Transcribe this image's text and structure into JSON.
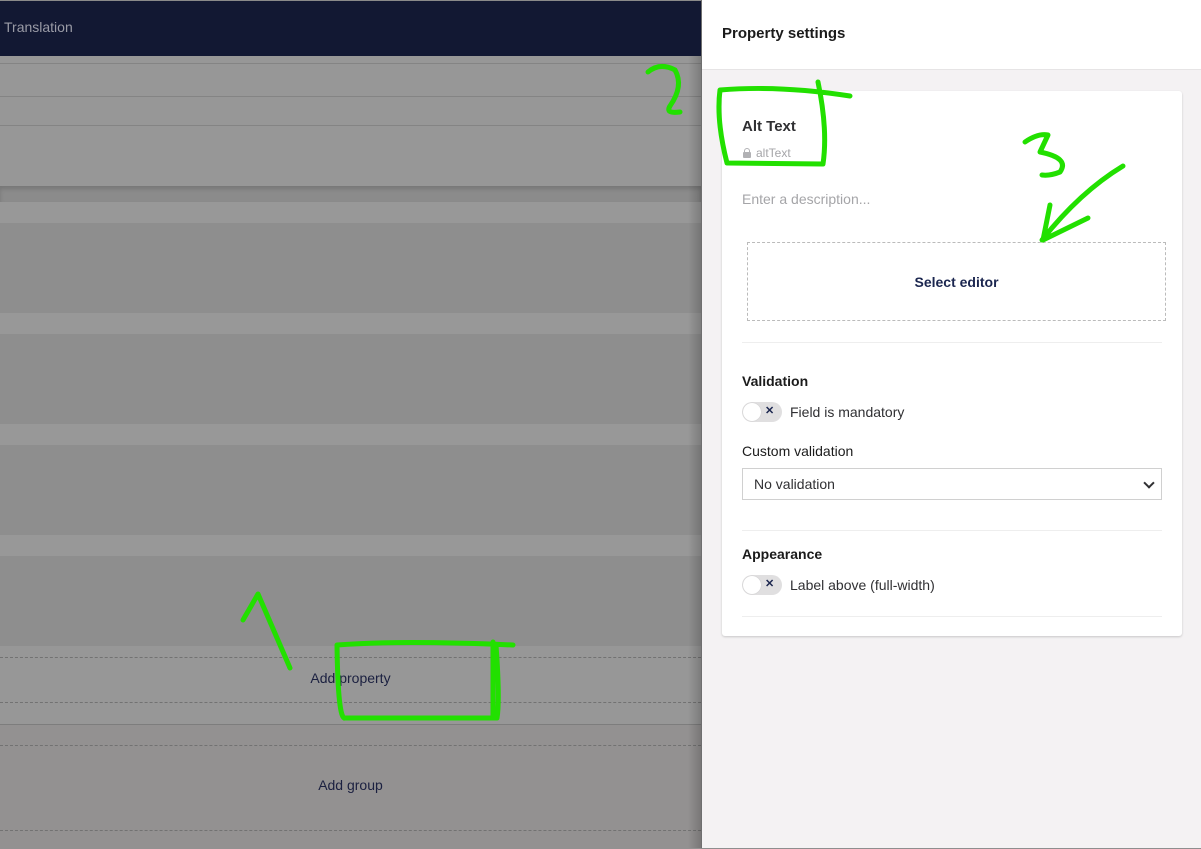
{
  "background": {
    "topbar_title": "Translation",
    "add_property_label": "Add property",
    "add_group_label": "Add group"
  },
  "panel": {
    "title": "Property settings",
    "property": {
      "name": "Alt Text",
      "alias": "altText",
      "alias_icon": "lock-icon",
      "description_placeholder": "Enter a description..."
    },
    "select_editor_label": "Select editor",
    "validation": {
      "heading": "Validation",
      "mandatory_label": "Field is mandatory",
      "mandatory_on": false,
      "custom_label": "Custom validation",
      "custom_value": "No validation"
    },
    "appearance": {
      "heading": "Appearance",
      "label_above_label": "Label above (full-width)",
      "label_above_on": false
    }
  },
  "annotations": {
    "color": "#22e000",
    "marks": [
      "1",
      "2",
      "3"
    ]
  }
}
